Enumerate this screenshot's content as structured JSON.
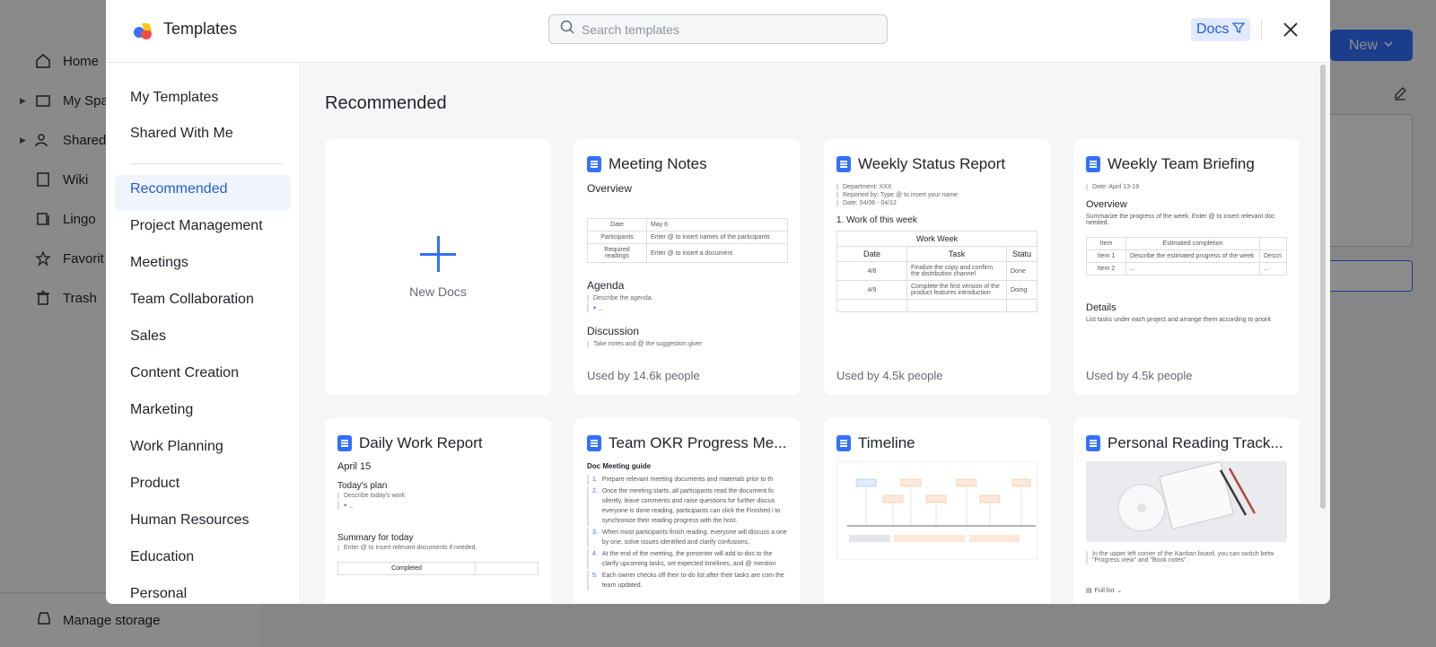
{
  "background": {
    "sidebar": [
      {
        "label": "Home",
        "icon": "home-icon",
        "caret": false
      },
      {
        "label": "My Spa",
        "icon": "folder-icon",
        "caret": true
      },
      {
        "label": "Shared",
        "icon": "people-icon",
        "caret": true
      },
      {
        "label": "Wiki",
        "icon": "wiki-icon",
        "caret": false
      },
      {
        "label": "Lingo",
        "icon": "lingo-icon",
        "caret": false
      },
      {
        "label": "Favorit",
        "icon": "star-icon",
        "caret": false
      },
      {
        "label": "Trash",
        "icon": "trash-icon",
        "caret": false
      }
    ],
    "manage_storage": "Manage storage",
    "new_button": "New"
  },
  "modal": {
    "title": "Templates",
    "search_placeholder": "Search templates",
    "filter_label": "Docs",
    "accent": "#3370ff",
    "nav_top": [
      "My Templates",
      "Shared With Me"
    ],
    "nav_categories": [
      "Recommended",
      "Project Management",
      "Meetings",
      "Team Collaboration",
      "Sales",
      "Content Creation",
      "Marketing",
      "Work Planning",
      "Product",
      "Human Resources",
      "Education",
      "Personal"
    ],
    "active_category": "Recommended",
    "section_title": "Recommended",
    "new_docs_label": "New Docs",
    "cards": [
      {
        "title": "Meeting Notes",
        "used": "Used by 14.6k people"
      },
      {
        "title": "Weekly Status Report",
        "used": "Used by 4.5k people"
      },
      {
        "title": "Weekly Team Briefing",
        "used": "Used by 4.5k people"
      },
      {
        "title": "Daily Work Report",
        "used": ""
      },
      {
        "title": "Team OKR Progress Me...",
        "used": ""
      },
      {
        "title": "Timeline",
        "used": ""
      },
      {
        "title": "Personal Reading Track...",
        "used": ""
      }
    ],
    "previews": {
      "meeting_notes": {
        "overview": "Overview",
        "rows": [
          [
            "Date",
            "May 6"
          ],
          [
            "Participants",
            "Enter @ to insert names of the participants"
          ],
          [
            "Required readings",
            "Enter @ to insert a document"
          ]
        ],
        "agenda": "Agenda",
        "agenda_text": "Describe the agenda.",
        "discussion": "Discussion",
        "discussion_text": "Take notes and @ the suggestion giver"
      },
      "weekly_status": {
        "dept": "Department: XXX",
        "reported": "Reported by: Type @ to insert your name",
        "date": "Date: 04/06 - 04/12",
        "heading": "1. Work of this week",
        "table_title": "Work Week",
        "cols": [
          "Date",
          "Task",
          "Statu"
        ],
        "rows": [
          [
            "4/8",
            "Finalize the copy and confirm the distribution channel",
            "Done"
          ],
          [
            "4/9",
            "Complete the first version of the product features introduction",
            "Doing"
          ]
        ]
      },
      "weekly_briefing": {
        "date": "Date: April 13-19",
        "overview": "Overview",
        "overview_text": "Summarize the progress of the week. Enter @ to insert relevant doc needed.",
        "cols": [
          "Item",
          "Estimated completion",
          ""
        ],
        "rows": [
          [
            "Item 1",
            "Describe the estimated progress of the week",
            "Descri"
          ],
          [
            "Item 2",
            "...",
            "..."
          ]
        ],
        "details": "Details",
        "details_text": "List tasks under each project and arrange them according to priorit"
      },
      "daily_report": {
        "date": "April 15",
        "plan": "Today's plan",
        "plan_text": "Describe today's work",
        "summary": "Summary for today",
        "summary_text": "Enter @ to insert relevant documents if needed.",
        "completed": "Completed"
      },
      "okr": {
        "guide": "Doc Meeting guide",
        "items": [
          "Prepare relevant meeting documents and materials prior to th",
          "Once the meeting starts, all participants read the document fo silently, leave comments and raise questions for further discus everyone is done reading, participants can click the Finished i to synchronize their reading progress with the host.",
          "When most participants finish reading, everyone will discuss a one by one, solve issues identified and clarify confusions.",
          "At the end of the meeting, the presenter will add to-dos to the clarify upcoming tasks, set expected timelines, and @ mention",
          "Each owner checks off their to-do list after their tasks are com the team updated."
        ]
      },
      "reading": {
        "text": "In the upper left corner of the Kanban board, you can switch betw \"Progress view\" and \"Book notes\".",
        "full_list": "Full list"
      }
    }
  }
}
